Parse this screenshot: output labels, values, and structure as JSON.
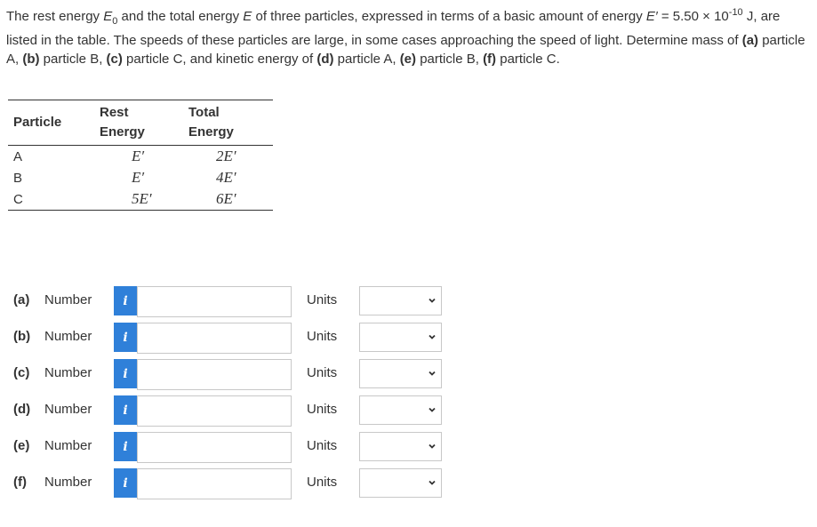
{
  "question": {
    "p1": "The rest energy ",
    "E0": "E",
    "E0_sub": "0",
    "p2": " and the total energy ",
    "E": "E",
    "p3": " of three particles, expressed in terms of a basic amount of energy ",
    "Eprime": "E′",
    "p4": " = 5.50 × 10",
    "exp": "-10",
    "p5": " J, are listed in the table. The speeds of these particles are large, in some cases approaching the speed of light. Determine mass of ",
    "a": "(a)",
    "a_text": " particle A, ",
    "b": "(b)",
    "b_text": " particle B, ",
    "c": "(c)",
    "c_text": " particle C, and kinetic energy of ",
    "d": "(d)",
    "d_text": " particle A, ",
    "e": "(e)",
    "e_text": " particle B, ",
    "f": "(f)",
    "f_text": " particle C."
  },
  "table": {
    "headers": {
      "particle": "Particle",
      "rest_1": "Rest",
      "rest_2": "Energy",
      "total_1": "Total",
      "total_2": "Energy"
    },
    "rows": [
      {
        "particle": "A",
        "rest": "E′",
        "total": "2E′"
      },
      {
        "particle": "B",
        "rest": "E′",
        "total": "4E′"
      },
      {
        "particle": "C",
        "rest": "5E′",
        "total": "6E′"
      }
    ]
  },
  "answers": [
    {
      "label": "(a)",
      "number_label": "Number",
      "info": "i",
      "value": "",
      "units_label": "Units",
      "units_value": ""
    },
    {
      "label": "(b)",
      "number_label": "Number",
      "info": "i",
      "value": "",
      "units_label": "Units",
      "units_value": ""
    },
    {
      "label": "(c)",
      "number_label": "Number",
      "info": "i",
      "value": "",
      "units_label": "Units",
      "units_value": ""
    },
    {
      "label": "(d)",
      "number_label": "Number",
      "info": "i",
      "value": "",
      "units_label": "Units",
      "units_value": ""
    },
    {
      "label": "(e)",
      "number_label": "Number",
      "info": "i",
      "value": "",
      "units_label": "Units",
      "units_value": ""
    },
    {
      "label": "(f)",
      "number_label": "Number",
      "info": "i",
      "value": "",
      "units_label": "Units",
      "units_value": ""
    }
  ],
  "colors": {
    "info_button": "#2f80d9",
    "text": "#333333",
    "border": "#c8c8c8"
  },
  "icons": {
    "info": "info-icon",
    "dropdown": "chevron-down-icon"
  }
}
